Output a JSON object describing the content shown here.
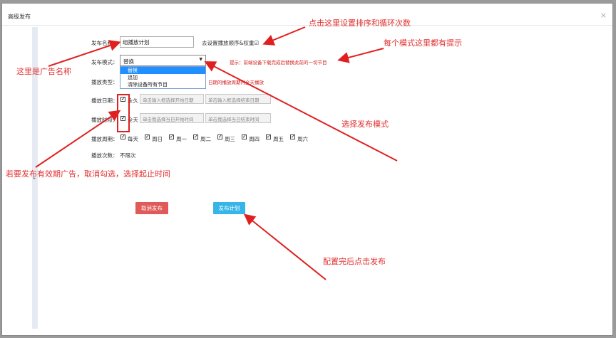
{
  "dialog": {
    "title": "高级发布",
    "close_symbol": "×"
  },
  "form": {
    "name_label": "发布名称：",
    "name_value": "组播放计划",
    "order_link": "去设置播放顺序&权重☑",
    "mode_label": "发布模式：",
    "mode_value": "替换",
    "mode_options": [
      "替换",
      "追加",
      "清除设备所有节目"
    ],
    "mode_hint": "提示：前端设备下载完成后替换此前的一切节目",
    "type_label": "播放类型：",
    "type_hint": "日期的播放周期内全天播放",
    "date_label": "播放日期：",
    "date_permanent": "永久",
    "date_start_placeholder": "单击输入框选择开始日期",
    "date_end_placeholder": "单击输入框选择结束日期",
    "time_label": "播放时段：",
    "time_allday": "全天",
    "time_start_placeholder": "单击我选择当日开始时间",
    "time_end_placeholder": "单击我选择当日结束时间",
    "cycle_label": "播放周期：",
    "days": [
      "每天",
      "周日",
      "周一",
      "周二",
      "周三",
      "周四",
      "周五",
      "周六"
    ],
    "count_label": "播放次数：",
    "count_value": "不限次"
  },
  "buttons": {
    "cancel": "取消发布",
    "publish": "发布计划"
  },
  "annotations": {
    "order": "点击这里设置排序和循环次数",
    "hint": "每个模式这里都有提示",
    "name": "这里是广告名称",
    "mode": "选择发布模式",
    "validity": "若要发布有效期广告，取消勾选，选择起止时间",
    "publish": "配置完后点击发布"
  },
  "colors": {
    "cancel_btn": "#e05a5a",
    "publish_btn": "#35b5e8",
    "annotation": "#e23030",
    "selected_option": "#1e90ff"
  }
}
